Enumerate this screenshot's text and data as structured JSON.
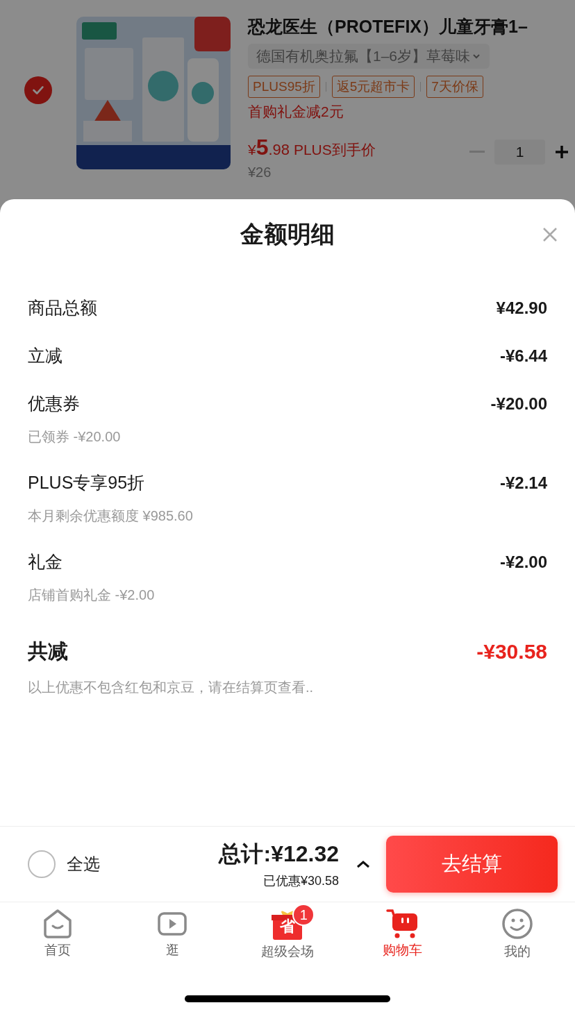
{
  "product": {
    "checked": true,
    "title": "恐龙医生（PROTEFIX）儿童牙膏1–",
    "variant": "德国有机奥拉氟【1–6岁】草莓味",
    "tags": [
      "PLUS95折",
      "返5元超市卡",
      "7天价保"
    ],
    "promo": "首购礼金减2元",
    "price": {
      "currency": "¥",
      "integer": "5",
      "decimal": ".98",
      "label": "PLUS到手价"
    },
    "original_price": "¥26",
    "quantity": "1"
  },
  "sheet": {
    "title": "金额明细",
    "rows": [
      {
        "label": "商品总额",
        "value": "¥42.90"
      },
      {
        "label": "立减",
        "value": "-¥6.44"
      },
      {
        "label": "优惠券",
        "value": "-¥20.00",
        "note": "已领券 -¥20.00"
      },
      {
        "label": "PLUS专享95折",
        "value": "-¥2.14",
        "note": "本月剩余优惠额度 ¥985.60"
      },
      {
        "label": "礼金",
        "value": "-¥2.00",
        "note": "店铺首购礼金 -¥2.00"
      }
    ],
    "total": {
      "label": "共减",
      "value": "-¥30.58",
      "note": "以上优惠不包含红包和京豆，请在结算页查看.."
    }
  },
  "checkout": {
    "select_all": {
      "label": "全选",
      "checked": false
    },
    "total": "总计:¥12.32",
    "saved": "已优惠¥30.58",
    "button": "去结算"
  },
  "tabs": [
    {
      "label": "首页",
      "kind": "home",
      "selected": false
    },
    {
      "label": "逛",
      "kind": "video",
      "selected": false
    },
    {
      "label": "超级会场",
      "kind": "gift",
      "selected": false,
      "glyph": "省",
      "badge": "1"
    },
    {
      "label": "购物车",
      "kind": "cart",
      "selected": true
    },
    {
      "label": "我的",
      "kind": "smile",
      "selected": false
    }
  ]
}
